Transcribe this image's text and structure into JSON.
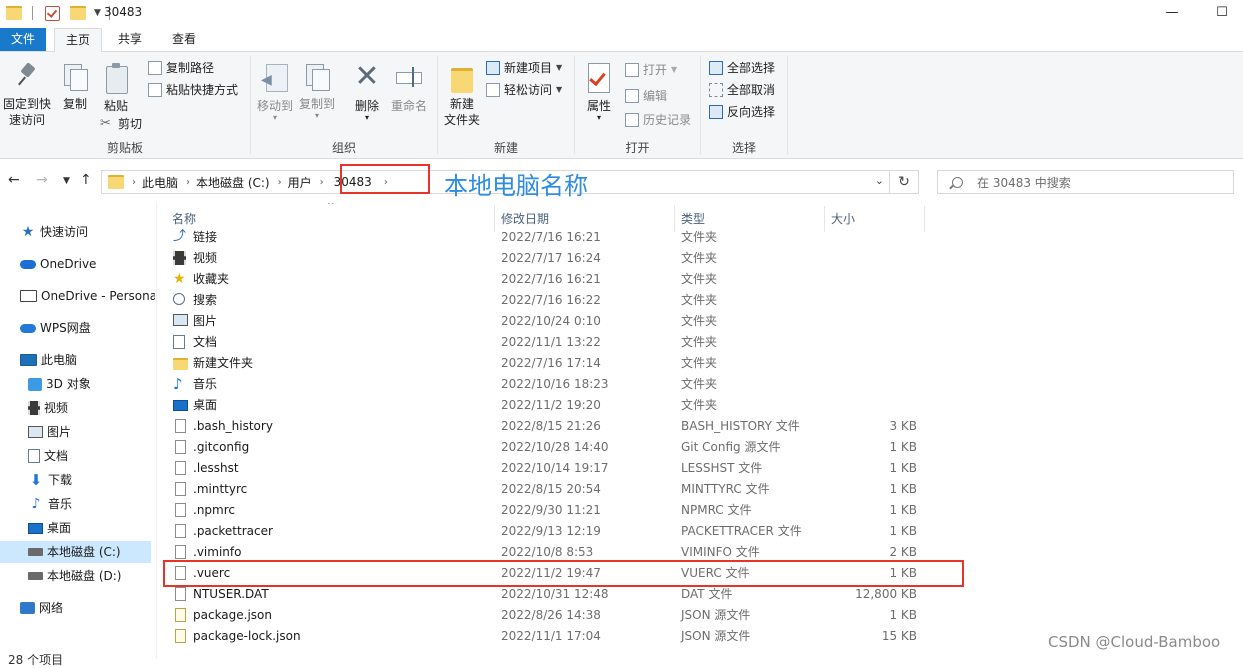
{
  "window": {
    "title": "30483",
    "minimize": "—",
    "maximize": "☐"
  },
  "ribbon_tabs": [
    "文件",
    "主页",
    "共享",
    "查看"
  ],
  "ribbon": {
    "clipboard": {
      "pin_label_1": "固定到快",
      "pin_label_2": "速访问",
      "copy": "复制",
      "paste": "粘贴",
      "copy_path": "复制路径",
      "paste_shortcut": "粘贴快捷方式",
      "cut": "剪切",
      "group": "剪贴板"
    },
    "organize": {
      "move_to": "移动到",
      "copy_to": "复制到",
      "delete": "删除",
      "rename": "重命名",
      "group": "组织"
    },
    "new": {
      "new_folder_1": "新建",
      "new_folder_2": "文件夹",
      "new_item": "新建项目",
      "easy_access": "轻松访问",
      "group": "新建"
    },
    "open": {
      "properties": "属性",
      "open": "打开",
      "edit": "编辑",
      "history": "历史记录",
      "group": "打开"
    },
    "select": {
      "select_all": "全部选择",
      "select_none": "全部取消",
      "invert": "反向选择",
      "group": "选择"
    }
  },
  "address": {
    "crumbs": [
      "此电脑",
      "本地磁盘 (C:)",
      "用户",
      "30483"
    ],
    "annotation": "本地电脑名称"
  },
  "search": {
    "placeholder": "在 30483 中搜索"
  },
  "nav_pane": {
    "items": [
      {
        "label": "快速访问",
        "icon": "star-icon"
      },
      {
        "label": "OneDrive",
        "icon": "cloud-icon"
      },
      {
        "label": "OneDrive - Persona",
        "icon": "pc-icon"
      },
      {
        "label": "WPS网盘",
        "icon": "cloud-icon"
      },
      {
        "label": "此电脑",
        "icon": "computer-icon"
      },
      {
        "label": "3D 对象",
        "icon": "3d-objects-icon"
      },
      {
        "label": "视频",
        "icon": "video-icon"
      },
      {
        "label": "图片",
        "icon": "picture-icon"
      },
      {
        "label": "文档",
        "icon": "document-icon"
      },
      {
        "label": "下载",
        "icon": "download-icon"
      },
      {
        "label": "音乐",
        "icon": "music-icon"
      },
      {
        "label": "桌面",
        "icon": "desktop-icon"
      },
      {
        "label": "本地磁盘 (C:)",
        "icon": "drive-icon",
        "selected": true
      },
      {
        "label": "本地磁盘 (D:)",
        "icon": "drive-icon"
      },
      {
        "label": "网络",
        "icon": "network-icon"
      }
    ]
  },
  "columns": {
    "name": "名称",
    "date": "修改日期",
    "type": "类型",
    "size": "大小"
  },
  "files": [
    {
      "name": "链接",
      "date": "2022/7/16 16:21",
      "type": "文件夹",
      "size": "",
      "icon": "link-icon"
    },
    {
      "name": "视频",
      "date": "2022/7/17 16:24",
      "type": "文件夹",
      "size": "",
      "icon": "video-icon"
    },
    {
      "name": "收藏夹",
      "date": "2022/7/16 16:21",
      "type": "文件夹",
      "size": "",
      "icon": "star-icon"
    },
    {
      "name": "搜索",
      "date": "2022/7/16 16:22",
      "type": "文件夹",
      "size": "",
      "icon": "search-icon"
    },
    {
      "name": "图片",
      "date": "2022/10/24 0:10",
      "type": "文件夹",
      "size": "",
      "icon": "picture-icon"
    },
    {
      "name": "文档",
      "date": "2022/11/1 13:22",
      "type": "文件夹",
      "size": "",
      "icon": "document-icon"
    },
    {
      "name": "新建文件夹",
      "date": "2022/7/16 17:14",
      "type": "文件夹",
      "size": "",
      "icon": "folder-icon"
    },
    {
      "name": "音乐",
      "date": "2022/10/16 18:23",
      "type": "文件夹",
      "size": "",
      "icon": "music-icon"
    },
    {
      "name": "桌面",
      "date": "2022/11/2 19:20",
      "type": "文件夹",
      "size": "",
      "icon": "desktop-icon"
    },
    {
      "name": ".bash_history",
      "date": "2022/8/15 21:26",
      "type": "BASH_HISTORY 文件",
      "size": "3 KB",
      "icon": "file-icon"
    },
    {
      "name": ".gitconfig",
      "date": "2022/10/28 14:40",
      "type": "Git Config 源文件",
      "size": "1 KB",
      "icon": "gear-file-icon"
    },
    {
      "name": ".lesshst",
      "date": "2022/10/14 19:17",
      "type": "LESSHST 文件",
      "size": "1 KB",
      "icon": "file-icon"
    },
    {
      "name": ".minttyrc",
      "date": "2022/8/15 20:54",
      "type": "MINTTYRC 文件",
      "size": "1 KB",
      "icon": "file-icon"
    },
    {
      "name": ".npmrc",
      "date": "2022/9/30 11:21",
      "type": "NPMRC 文件",
      "size": "1 KB",
      "icon": "file-icon"
    },
    {
      "name": ".packettracer",
      "date": "2022/9/13 12:19",
      "type": "PACKETTRACER 文件",
      "size": "1 KB",
      "icon": "file-icon"
    },
    {
      "name": ".viminfo",
      "date": "2022/10/8 8:53",
      "type": "VIMINFO 文件",
      "size": "2 KB",
      "icon": "file-icon"
    },
    {
      "name": ".vuerc",
      "date": "2022/11/2 19:47",
      "type": "VUERC 文件",
      "size": "1 KB",
      "icon": "file-icon",
      "highlighted": true
    },
    {
      "name": "NTUSER.DAT",
      "date": "2022/10/31 12:48",
      "type": "DAT 文件",
      "size": "12,800 KB",
      "icon": "file-icon"
    },
    {
      "name": "package.json",
      "date": "2022/8/26 14:38",
      "type": "JSON 源文件",
      "size": "1 KB",
      "icon": "json-icon"
    },
    {
      "name": "package-lock.json",
      "date": "2022/11/1 17:04",
      "type": "JSON 源文件",
      "size": "15 KB",
      "icon": "json-icon"
    }
  ],
  "status": "28 个项目",
  "watermark": "CSDN @Cloud-Bamboo",
  "colors": {
    "accent": "#1979ca",
    "highlight_box": "#e8332b",
    "annotation": "#2f8de0",
    "selection": "#cce8ff"
  }
}
